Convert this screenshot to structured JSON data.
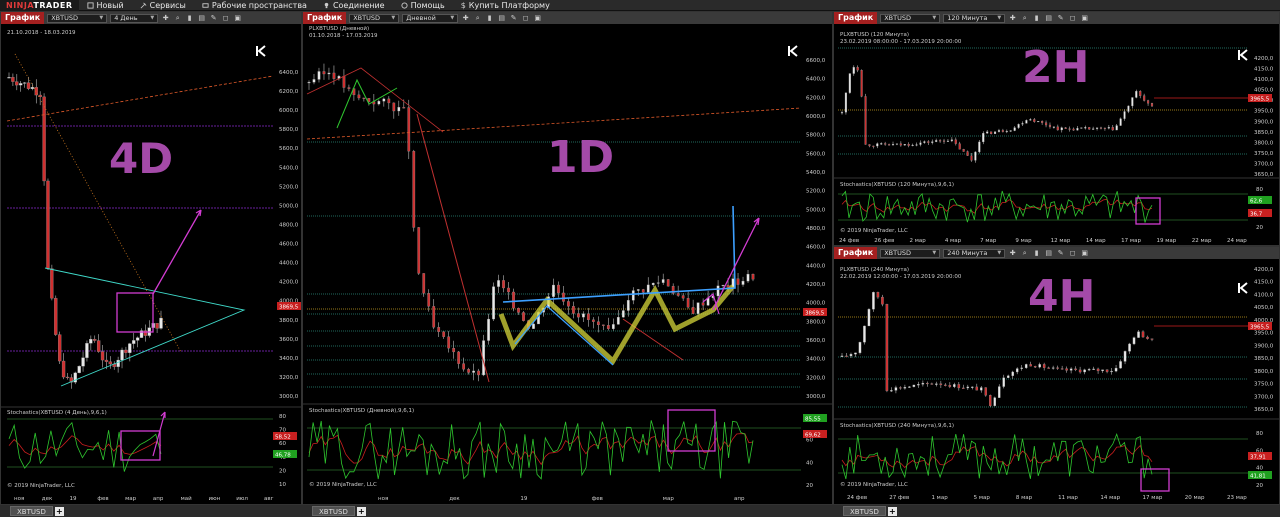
{
  "app": {
    "logo": "NINJATRADER",
    "menu": [
      {
        "icon": "new-icon",
        "label": "Новый"
      },
      {
        "icon": "services-icon",
        "label": "Сервисы"
      },
      {
        "icon": "workspace-icon",
        "label": "Рабочие пространства"
      },
      {
        "icon": "connection-icon",
        "label": "Соединение"
      },
      {
        "icon": "help-icon",
        "label": "Помощь"
      },
      {
        "icon": "dollar-icon",
        "label": "Купить Платформу"
      }
    ]
  },
  "colors": {
    "title_red": "#a42020",
    "candle_up": "#e8e8e8",
    "candle_down": "#d03030",
    "stoch_k": "#2fc72f",
    "stoch_d": "#c81e1e",
    "magenta": "#d23cd2",
    "tag": "#a44aa8",
    "trend_blue": "#3da0ff",
    "trend_cyan": "#3fd9c9",
    "trend_orange": "#e05a2a",
    "yellow_hl": "#d6d63a",
    "grid_green": "#2a6a2a"
  },
  "charts": {
    "c4d": {
      "title": "График",
      "instrument": "XBTUSD",
      "interval": "4 День",
      "range_label": "21.10.2018 - 18.03.2019",
      "tag": "4D",
      "y_ticks": [
        "6400,0",
        "6200,0",
        "6000,0",
        "5800,0",
        "5600,0",
        "5400,0",
        "5200,0",
        "5000,0",
        "4800,0",
        "4600,0",
        "4400,0",
        "4200,0",
        "4000,0",
        "3800,0",
        "3600,0",
        "3400,0",
        "3200,0",
        "3000,0"
      ],
      "price_badge": "3869,5",
      "stoch_label": "Stochastics(XBTUSD (4 День),9,6,1)",
      "stoch_ticks": [
        "80",
        "70",
        "60",
        "40",
        "20",
        "10"
      ],
      "stoch_badges": [
        "58,52",
        "46,78"
      ],
      "x_labels": [
        "ноя",
        "дек",
        "19",
        "фев",
        "мар",
        "апр",
        "май",
        "июн",
        "июл",
        "авг"
      ],
      "copyright": "© 2019 NinjaTrader, LLC",
      "tab": "XBTUSD"
    },
    "c1d": {
      "title": "График",
      "instrument": "XBTUSD",
      "interval": "Дневной",
      "header1": "PLXBTUSD (Дневной)",
      "header2": "01.10.2018 - 17.03.2019",
      "tag": "1D",
      "y_ticks": [
        "6600,0",
        "6400,0",
        "6200,0",
        "6000,0",
        "5800,0",
        "5600,0",
        "5400,0",
        "5200,0",
        "5000,0",
        "4800,0",
        "4600,0",
        "4400,0",
        "4200,0",
        "4000,0",
        "3800,0",
        "3600,0",
        "3400,0",
        "3200,0",
        "3000,0"
      ],
      "price_badge": "3869,5",
      "stoch_label": "Stochastics(XBTUSD (Дневной),9,6,1)",
      "stoch_ticks": [
        "80",
        "60",
        "40",
        "20"
      ],
      "stoch_badges": [
        "85,55",
        "69,62"
      ],
      "x_labels": [
        "ноя",
        "дек",
        "19",
        "фев",
        "мар",
        "апр"
      ],
      "copyright": "© 2019 NinjaTrader, LLC",
      "tab": "XBTUSD"
    },
    "c2h": {
      "title": "График",
      "instrument": "XBTUSD",
      "interval": "120 Минута",
      "header1": "PLXBTUSD (120 Минута)",
      "header2": "23.02.2019 08:00:00 - 17.03.2019 20:00:00",
      "tag": "2H",
      "y_ticks": [
        "4200,0",
        "4150,0",
        "4100,0",
        "4050,0",
        "4000,0",
        "3950,0",
        "3900,0",
        "3850,0",
        "3800,0",
        "3750,0",
        "3700,0",
        "3650,0"
      ],
      "price_badge": "3965,5",
      "stoch_label": "Stochastics(XBTUSD (120 Минута),9,6,1)",
      "stoch_ticks": [
        "80",
        "60",
        "40",
        "20"
      ],
      "stoch_badges": [
        "62,6",
        "36,7"
      ],
      "x_labels": [
        "24 фев",
        "26 фев",
        "2 мар",
        "4 мар",
        "7 мар",
        "9 мар",
        "12 мар",
        "14 мар",
        "17 мар",
        "19 мар",
        "22 мар",
        "24 мар"
      ],
      "copyright": "© 2019 NinjaTrader, LLC",
      "tab": "XBTUSD"
    },
    "c4h": {
      "title": "График",
      "instrument": "XBTUSD",
      "interval": "240 Минута",
      "header1": "PLXBTUSD (240 Минута)",
      "header2": "22.02.2019 12:00:00 - 17.03.2019 20:00:00",
      "tag": "4H",
      "y_ticks": [
        "4200,0",
        "4150,0",
        "4100,0",
        "4050,0",
        "4000,0",
        "3950,0",
        "3900,0",
        "3850,0",
        "3800,0",
        "3750,0",
        "3700,0",
        "3650,0"
      ],
      "price_badge": "3965,5",
      "stoch_label": "Stochastics(XBTUSD (240 Минута),9,6,1)",
      "stoch_ticks": [
        "80",
        "60",
        "40",
        "20"
      ],
      "stoch_badges": [
        "37,91",
        "41,81"
      ],
      "x_labels": [
        "24 фев",
        "27 фев",
        "1 мар",
        "5 мар",
        "8 мар",
        "11 мар",
        "14 мар",
        "17 мар",
        "20 мар",
        "23 мар"
      ],
      "copyright": "© 2019 NinjaTrader, LLC",
      "tab": "XBTUSD"
    }
  }
}
